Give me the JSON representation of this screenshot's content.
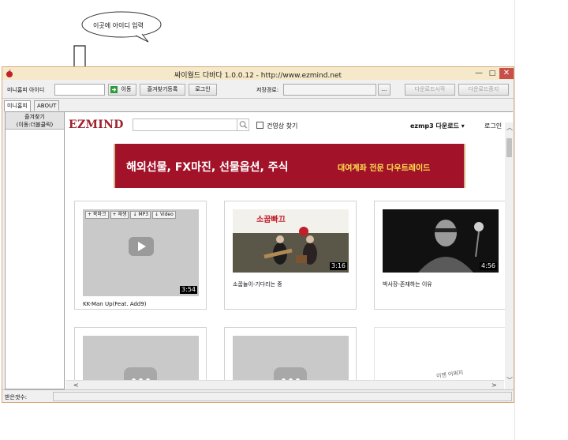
{
  "annotation": {
    "callout_text": "이곳에 아이디 입력"
  },
  "window": {
    "title": "싸이월드 다바다 1.0.0.12 - http://www.ezmind.net",
    "minimize_glyph": "—",
    "maximize_glyph": "□",
    "close_glyph": "✕"
  },
  "toolbar": {
    "minihompy_label": "미니홈피 아이디",
    "id_value": "",
    "go_label": "이동",
    "fav_register_label": "즐겨찾기등록",
    "login_label": "로그인",
    "save_path_label": "저장경로:",
    "save_path_value": "",
    "browse_label": "...",
    "download_start_label": "다운로드시작",
    "download_stop_label": "다운로드중지"
  },
  "tabs": [
    {
      "label": "미니홈피"
    },
    {
      "label": "ABOUT"
    }
  ],
  "sidebar": {
    "fav_title": "즐겨찾기",
    "fav_subtitle": "(이동:더블클릭)"
  },
  "browser": {
    "logo": "EZMIND",
    "search_placeholder": "",
    "checkbox_label": "건영상 찾기",
    "download_menu": "ezmp3 다운로드 ▾",
    "login_link": "로그인",
    "banner_main": "해외선물, FX마진, 선물옵션, 주식",
    "banner_sub": "대여계좌 전문 다우트레이드"
  },
  "cards": [
    {
      "title": "KK-Man Up(Feat. Add9)",
      "duration": "3:54",
      "tags": [
        "+ 북마크",
        "+ 재생",
        "↓ MP3",
        "↓ Video"
      ]
    },
    {
      "title": "소꿉놀이-기다리는 중",
      "duration": "3:16",
      "overlay": "소꿉빠끄"
    },
    {
      "title": "박사장-존재하는 이유",
      "duration": "4:56"
    },
    {
      "title": ""
    },
    {
      "title": ""
    },
    {
      "partial_text": "이젠 어쩌지"
    }
  ],
  "status": {
    "label": "받은갯수:",
    "value": ""
  },
  "colors": {
    "accent": "#a2132a",
    "banner_sub": "#ffe44d",
    "title_bar": "#f6e9c9"
  }
}
